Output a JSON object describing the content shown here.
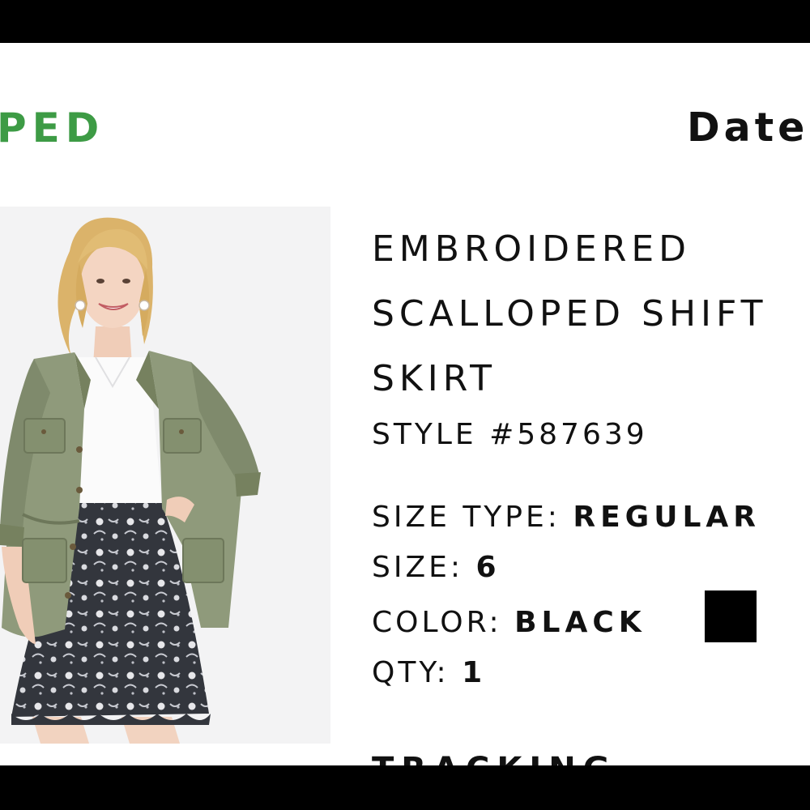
{
  "order": {
    "status_text": "PED",
    "date_label": "Date"
  },
  "product": {
    "name_lines": [
      "EMBROIDERED",
      "SCALLOPED SHIFT",
      "SKIRT"
    ],
    "style_label": "STYLE #587639",
    "size_type_label": "SIZE TYPE:",
    "size_type_value": "REGULAR",
    "size_label": "SIZE:",
    "size_value": "6",
    "color_label": "COLOR:",
    "color_value": "BLACK",
    "color_swatch": "#000000",
    "qty_label": "QTY:",
    "qty_value": "1"
  },
  "tracking": {
    "label": "TRACKING"
  },
  "colors": {
    "status_green": "#3d9b45",
    "text": "#111111"
  }
}
